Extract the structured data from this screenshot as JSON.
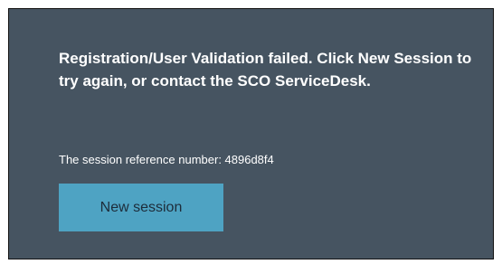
{
  "error": {
    "message": "Registration/User Validation failed. Click New Session to try again, or contact the SCO ServiceDesk.",
    "reference_text": "The session reference number: 4896d8f4"
  },
  "actions": {
    "new_session_label": "New session"
  },
  "colors": {
    "panel_background": "#465461",
    "button_background": "#4ea3c3",
    "text": "#ffffff"
  }
}
